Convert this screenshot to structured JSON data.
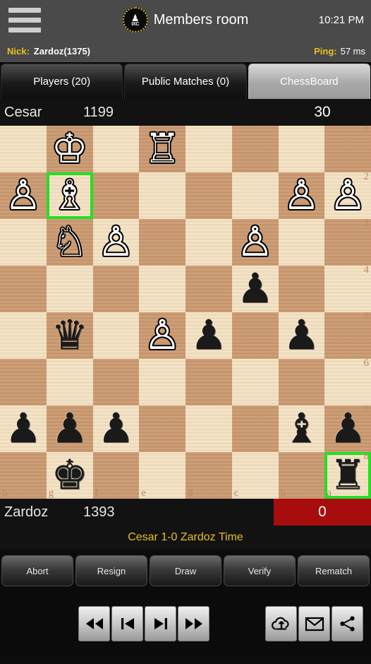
{
  "header": {
    "menu_icon": "hamburger-menu-icon",
    "logo_icon": "ixc-chess-logo-icon",
    "logo_text": "IXC",
    "title": "Members room",
    "time": "10:21 PM"
  },
  "nickbar": {
    "nick_label": "Nick:",
    "nick_value": "Zardoz(1375)",
    "ping_label": "Ping:",
    "ping_value": "57 ms"
  },
  "tabs": [
    {
      "label": "Players (20)",
      "active": false
    },
    {
      "label": "Public Matches (0)",
      "active": false
    },
    {
      "label": "ChessBoard",
      "active": true
    }
  ],
  "top_player": {
    "name": "Cesar",
    "rating": "1199",
    "clock": "30",
    "clock_alert": false
  },
  "bottom_player": {
    "name": "Zardoz",
    "rating": "1393",
    "clock": "0",
    "clock_alert": true
  },
  "status_message": "Cesar 1-0 Zardoz Time",
  "board": {
    "orientation": "black",
    "files": [
      "h",
      "g",
      "f",
      "e",
      "d",
      "c",
      "b",
      "a"
    ],
    "ranks": [
      "1",
      "2",
      "3",
      "4",
      "5",
      "6",
      "7",
      "8"
    ],
    "light_color": "#f5e3c4",
    "dark_color": "#cc9b72",
    "highlight_color": "#22e022",
    "highlighted_squares": [
      "g2",
      "a8"
    ],
    "rows": [
      [
        null,
        {
          "p": "K",
          "c": "w"
        },
        null,
        {
          "p": "R",
          "c": "w"
        },
        null,
        null,
        null,
        null
      ],
      [
        {
          "p": "P",
          "c": "w"
        },
        {
          "p": "B",
          "c": "w"
        },
        null,
        null,
        null,
        null,
        {
          "p": "P",
          "c": "w"
        },
        {
          "p": "P",
          "c": "w"
        }
      ],
      [
        null,
        {
          "p": "N",
          "c": "w"
        },
        {
          "p": "P",
          "c": "w"
        },
        null,
        null,
        {
          "p": "P",
          "c": "w"
        },
        null,
        null
      ],
      [
        null,
        null,
        null,
        null,
        null,
        {
          "p": "P",
          "c": "b"
        },
        null,
        null
      ],
      [
        null,
        {
          "p": "Q",
          "c": "b"
        },
        null,
        {
          "p": "P",
          "c": "w"
        },
        {
          "p": "P",
          "c": "b"
        },
        null,
        {
          "p": "P",
          "c": "b"
        },
        null
      ],
      [
        null,
        null,
        null,
        null,
        null,
        null,
        null,
        null
      ],
      [
        {
          "p": "P",
          "c": "b"
        },
        {
          "p": "P",
          "c": "b"
        },
        {
          "p": "P",
          "c": "b"
        },
        null,
        null,
        null,
        {
          "p": "B",
          "c": "b"
        },
        {
          "p": "P",
          "c": "b"
        }
      ],
      [
        null,
        {
          "p": "K",
          "c": "b"
        },
        null,
        null,
        null,
        null,
        null,
        {
          "p": "R",
          "c": "b"
        }
      ]
    ]
  },
  "actions": [
    {
      "label": "Abort"
    },
    {
      "label": "Resign"
    },
    {
      "label": "Draw"
    },
    {
      "label": "Verify"
    },
    {
      "label": "Rematch"
    }
  ],
  "navigation": {
    "left_buttons": [
      {
        "icon": "rewind-to-start-icon",
        "glyph": "◀◀"
      },
      {
        "icon": "step-backward-icon",
        "glyph": "◀❘"
      },
      {
        "icon": "step-forward-icon",
        "glyph": "▶❘"
      },
      {
        "icon": "fast-forward-icon",
        "glyph": "▶▶"
      }
    ],
    "right_buttons": [
      {
        "icon": "cloud-upload-icon"
      },
      {
        "icon": "mail-icon"
      },
      {
        "icon": "share-icon"
      }
    ]
  }
}
